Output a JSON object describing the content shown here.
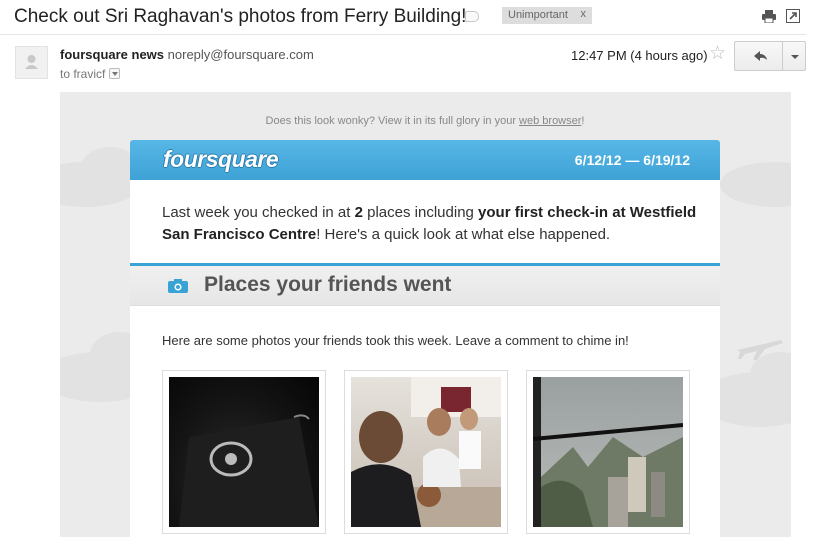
{
  "message": {
    "subject": "Check out Sri Raghavan's photos from Ferry Building!",
    "label": "Unimportant",
    "label_remove": "x",
    "sender_name": "foursquare news",
    "sender_email": "noreply@foursquare.com",
    "recipient": "to fravicf",
    "timestamp": "12:47 PM (4 hours ago)",
    "icons": [
      "label-icon",
      "print-icon",
      "new-window-icon",
      "avatar-icon",
      "star-icon",
      "reply-icon",
      "chevron-down-icon"
    ]
  },
  "email": {
    "wonky_prefix": "Does this look wonky? View it in its full glory in your ",
    "wonky_link": "web browser",
    "wonky_suffix": "!",
    "logo": "foursquare",
    "date_range": "6/12/12 — 6/19/12",
    "intro_1": "Last week you checked in at ",
    "intro_count": "2",
    "intro_2": " places including ",
    "intro_bold": "your first check-in at Westfield San Francisco Centre",
    "intro_3": "! Here's a quick look at what else happened.",
    "section_icon": "camera-icon",
    "section_title": "Places your friends went",
    "photos_intro": "Here are some photos your friends took this week. Leave a comment to chime in!",
    "photos": [
      "photo-1",
      "photo-2",
      "photo-3"
    ],
    "colors": {
      "accent": "#3ea2d6",
      "background": "#ebebeb"
    }
  }
}
